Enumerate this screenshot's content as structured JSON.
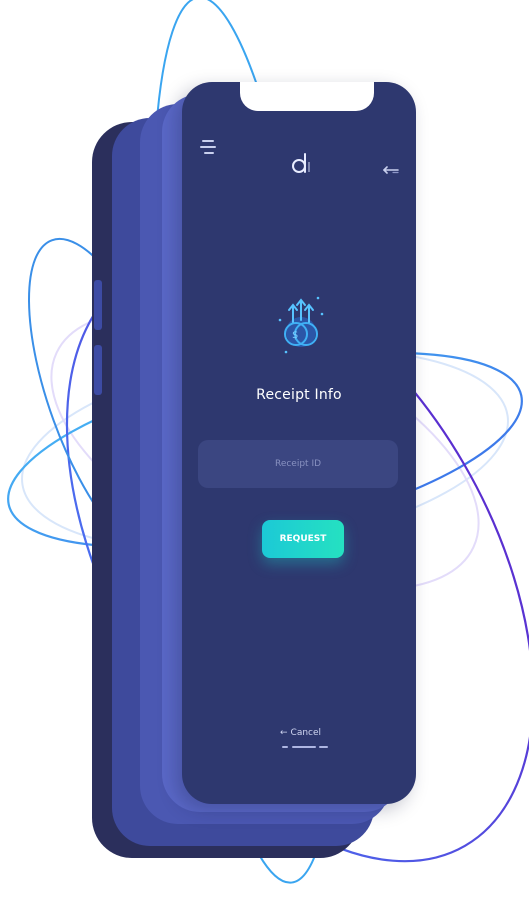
{
  "screen": {
    "title": "Receipt Info",
    "receipt_field": {
      "placeholder": "Receipt ID",
      "value": ""
    },
    "request_button_label": "REQUEST",
    "cancel_label": "Cancel"
  },
  "icons": {
    "menu": "menu-icon",
    "logo": "logo-icon",
    "back": "back-arrow-icon",
    "hero": "coins-upload-icon",
    "cancel": "left-arrow-icon"
  },
  "colors": {
    "screen_bg": "#2e386f",
    "accent_start": "#1cc9d6",
    "accent_end": "#25e1c1",
    "orbit_blue": "#3aa5f0",
    "orbit_purple": "#5a3fd8"
  }
}
